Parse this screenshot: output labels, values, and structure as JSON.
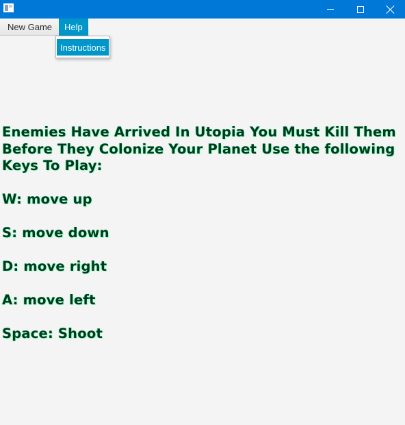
{
  "titlebar": {
    "icon": "app-window-icon",
    "controls": {
      "minimize": "minimize-icon",
      "maximize": "maximize-icon",
      "close": "close-icon"
    }
  },
  "menubar": {
    "items": [
      {
        "label": "New Game"
      },
      {
        "label": "Help"
      }
    ]
  },
  "help_menu": {
    "items": [
      {
        "label": "Instructions"
      }
    ]
  },
  "instructions": {
    "intro": "Enemies Have Arrived In Utopia You Must Kill Them Before They Colonize Your Planet Use the following Keys To Play:",
    "keys": [
      "W: move up",
      "S: move down",
      "D: move right",
      "A: move left",
      "Space: Shoot"
    ]
  },
  "colors": {
    "titlebar": "#0078d7",
    "menu_highlight": "#0096c9",
    "background": "#f4f4f4",
    "text": "#003a20",
    "text_glow": "#9cffc8"
  }
}
